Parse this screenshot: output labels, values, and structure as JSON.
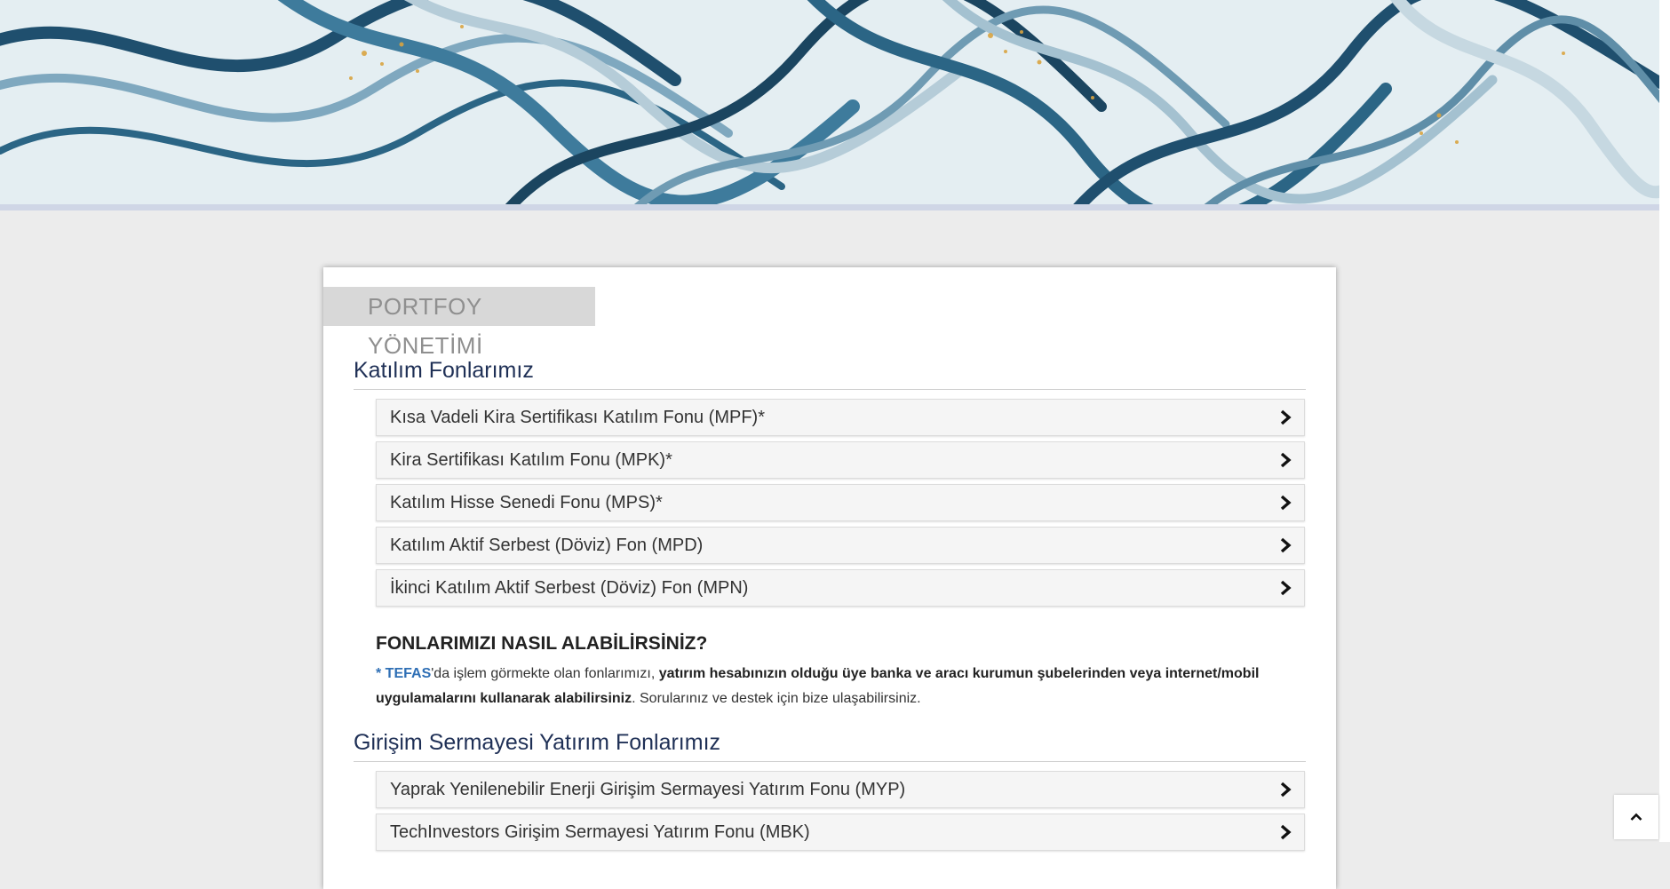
{
  "section": {
    "title": "PORTFOY YÖNETİMİ"
  },
  "katilim": {
    "heading": "Katılım Fonlarımız",
    "funds": [
      "Kısa Vadeli Kira Sertifikası Katılım Fonu (MPF)*",
      "Kira Sertifikası Katılım Fonu (MPK)*",
      "Katılım Hisse Senedi Fonu (MPS)*",
      "Katılım Aktif Serbest (Döviz) Fon (MPD)",
      "İkinci Katılım Aktif Serbest (Döviz) Fon (MPN)"
    ]
  },
  "how_to_buy": {
    "title": "FONLARIMIZI NASIL ALABİLİRSİNİZ?",
    "tefas_link": "* TEFAS",
    "text_part1": "'da işlem görmekte olan fonlarımızı, ",
    "text_bold": "yatırım hesabınızın olduğu üye banka ve aracı kurumun şubelerinden veya internet/mobil uygulamalarını kullanarak alabilirsiniz",
    "text_part2": ". Sorularınız ve destek için bize ulaşabilirsiniz."
  },
  "girisim": {
    "heading": "Girişim Sermayesi Yatırım Fonlarımız",
    "funds": [
      "Yaprak Yenilenebilir Enerji Girişim Sermayesi Yatırım Fonu (MYP)",
      "TechInvestors Girişim Sermayesi Yatırım Fonu (MBK)"
    ]
  },
  "icons": {
    "fund_expand": "chevron-right-icon",
    "back_to_top": "chevron-up-icon"
  },
  "colors": {
    "heading": "#1f3056",
    "link": "#2f6fb5",
    "page_bg": "#ececec"
  }
}
